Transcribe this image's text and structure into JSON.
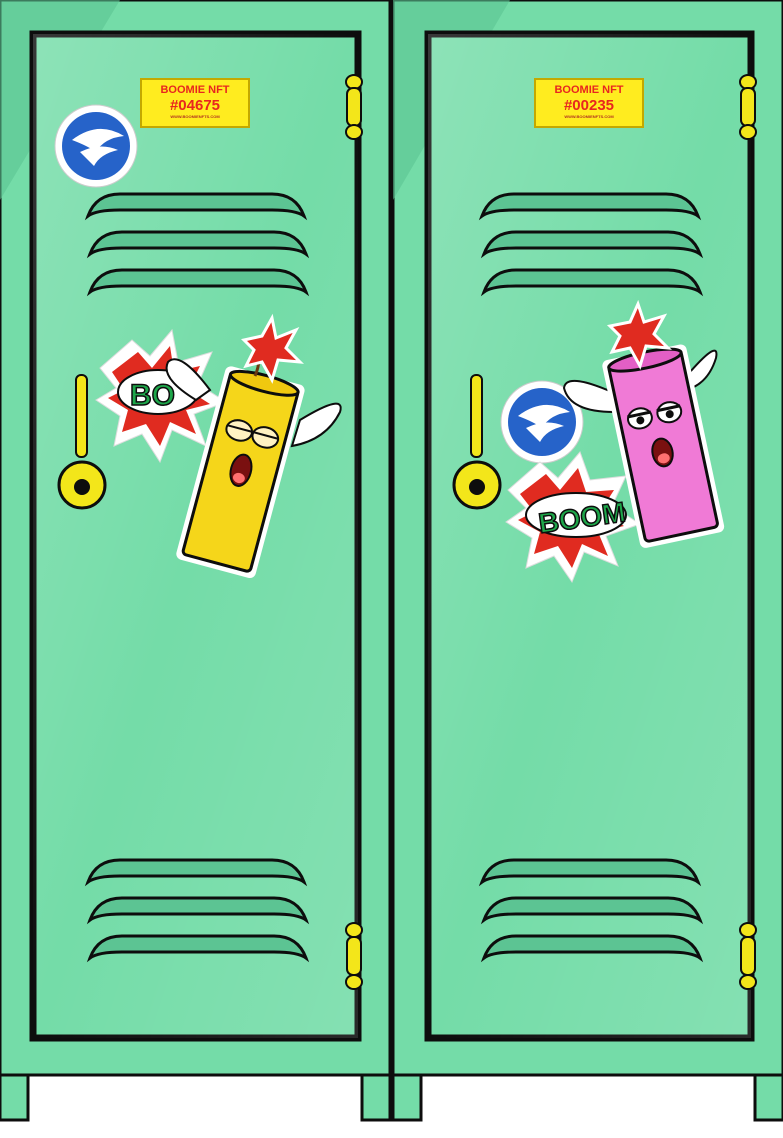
{
  "scene": {
    "description_name": "two lockers"
  },
  "lockers": [
    {
      "plate": {
        "title": "BOOMIE NFT",
        "number": "#04675",
        "url": "WWW.BOOMIENFTS.COM"
      },
      "sticker_text": "BO",
      "character_color": "#f5d61a"
    },
    {
      "plate": {
        "title": "BOOMIE NFT",
        "number": "#00235",
        "url": "WWW.BOOMIENFTS.COM"
      },
      "sticker_text": "BOOM",
      "character_color": "#f07ad6"
    }
  ],
  "colors": {
    "locker": "#74dca8",
    "locker_dark": "#5cc493",
    "outline": "#0d0d0d",
    "hardware": "#f3e61a",
    "badge": "#2663c9",
    "boom_red": "#e02b20",
    "boom_green": "#1ea64a"
  }
}
